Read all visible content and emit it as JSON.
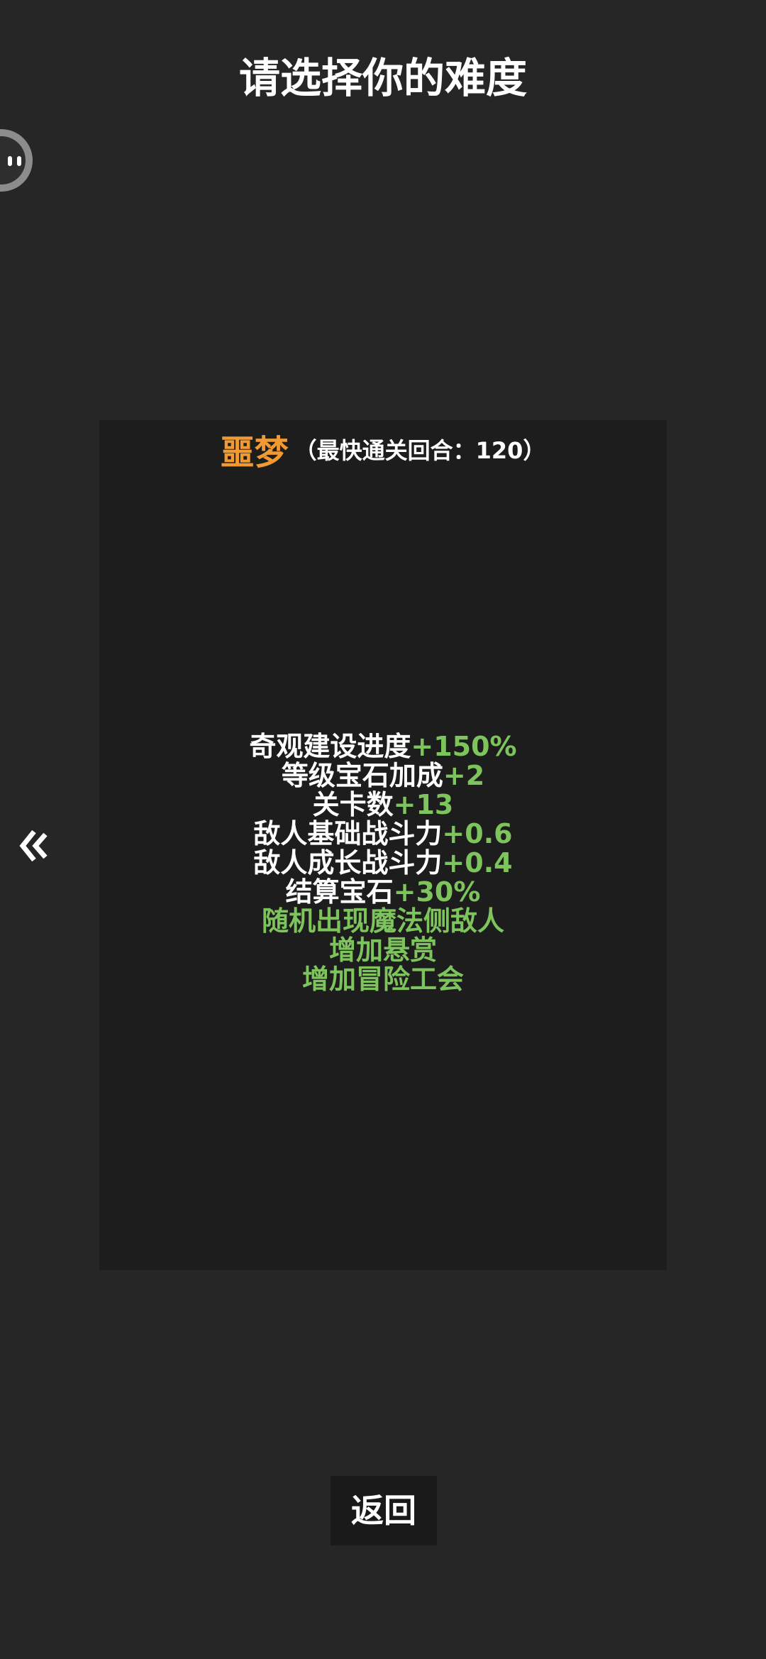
{
  "header": {
    "title": "请选择你的难度"
  },
  "difficulty": {
    "name": "噩梦",
    "fastest_clear": "（最快通关回合：120）",
    "bonuses": [
      {
        "label": "奇观建设进度",
        "value": "+150%"
      },
      {
        "label": "等级宝石加成",
        "value": "+2"
      },
      {
        "label": "关卡数",
        "value": "+13"
      },
      {
        "label": "敌人基础战斗力",
        "value": "+0.6"
      },
      {
        "label": "敌人成长战斗力",
        "value": "+0.4"
      },
      {
        "label": "结算宝石",
        "value": "+30%"
      }
    ],
    "features": [
      "随机出现魔法侧敌人",
      "增加悬赏",
      "增加冒险工会"
    ]
  },
  "footer": {
    "back_label": "返回"
  },
  "icons": {
    "prev": "double-chevron-left-icon",
    "assistant": "assistant-bubble-icon"
  },
  "colors": {
    "background": "#262626",
    "card": "#1d1d1d",
    "difficulty_accent": "#f19a33",
    "bonus_value": "#7ec45c",
    "text": "#ffffff"
  }
}
